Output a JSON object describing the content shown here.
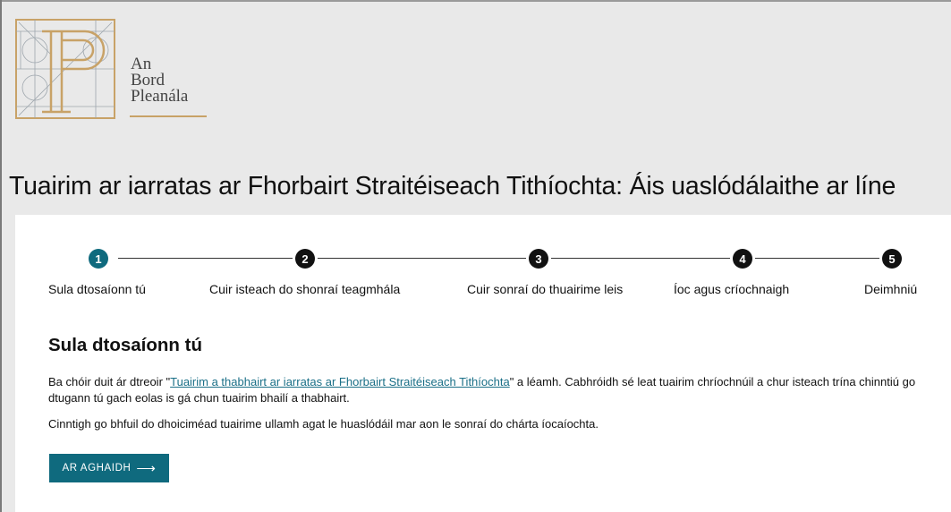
{
  "brand": {
    "line1": "An",
    "line2": "Bord",
    "line3": "Pleanála",
    "gold_color": "#c8a267"
  },
  "page_title": "Tuairim ar iarratas ar Fhorbairt Straitéiseach Tithíochta: Áis uaslódálaithe ar líne",
  "steps": [
    {
      "number": "1",
      "label": "Sula dtosaíonn tú",
      "active": true
    },
    {
      "number": "2",
      "label": "Cuir isteach do shonraí teagmhála",
      "active": false
    },
    {
      "number": "3",
      "label": "Cuir sonraí do thuairime leis",
      "active": false
    },
    {
      "number": "4",
      "label": "Íoc agus críochnaigh",
      "active": false
    },
    {
      "number": "5",
      "label": "Deimhniú",
      "active": false
    }
  ],
  "section": {
    "heading": "Sula dtosaíonn tú",
    "para1_before": "Ba chóir duit ár dtreoir \"",
    "para1_link": "Tuairim a thabhairt ar iarratas ar Fhorbairt Straitéiseach Tithíochta",
    "para1_after": "\" a léamh. Cabhróidh sé leat tuairim chríochnúil a chur isteach trína chinntiú go dtugann tú gach eolas is gá chun tuairim bhailí a thabhairt.",
    "para2": "Cinntigh go bhfuil do dhoiciméad tuairime ullamh agat le huaslódáil mar aon le sonraí do chárta íocaíochta."
  },
  "next_button": {
    "label": "AR AGHAIDH",
    "icon": "arrow-right-icon"
  },
  "colors": {
    "accent": "#0f6a7e",
    "link": "#1a6f87",
    "background": "#e9e9e9"
  }
}
